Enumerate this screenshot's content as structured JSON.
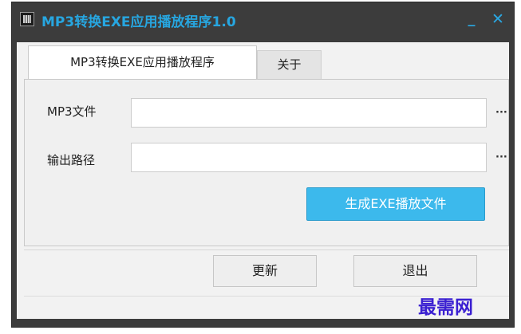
{
  "window": {
    "title": "MP3转换EXE应用播放程序1.0",
    "minimize_label": "_",
    "close_label": "✕"
  },
  "tabs": [
    {
      "label": "MP3转换EXE应用播放程序",
      "active": true
    },
    {
      "label": "关于",
      "active": false
    }
  ],
  "form": {
    "mp3_label": "MP3文件",
    "mp3_value": "",
    "mp3_browse": "···",
    "output_label": "输出路径",
    "output_value": "",
    "output_browse": "···",
    "generate_label": "生成EXE播放文件"
  },
  "footer": {
    "update_label": "更新",
    "exit_label": "退出"
  },
  "watermark": "最需网",
  "colors": {
    "title": "#27a6e0",
    "primary_button": "#3cb9ec",
    "window_frame": "#3c3c3c"
  }
}
